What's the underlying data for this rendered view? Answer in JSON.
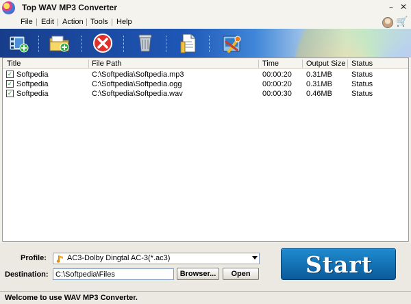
{
  "app": {
    "title": "Top WAV MP3 Converter"
  },
  "menu": [
    "File",
    "Edit",
    "Action",
    "Tools",
    "Help"
  ],
  "toolbar": {
    "buttons": [
      "add-video-files",
      "add-folder",
      "remove",
      "clear-all",
      "output-settings",
      "convert-settings"
    ]
  },
  "list": {
    "columns": [
      "Title",
      "File Path",
      "Time",
      "Output Size",
      "Status"
    ],
    "rows": [
      {
        "checked": true,
        "title": "Softpedia",
        "path": "C:\\Softpedia\\Softpedia.mp3",
        "time": "00:00:20",
        "size": "0.31MB",
        "status": "Status"
      },
      {
        "checked": true,
        "title": "Softpedia",
        "path": "C:\\Softpedia\\Softpedia.ogg",
        "time": "00:00:20",
        "size": "0.31MB",
        "status": "Status"
      },
      {
        "checked": true,
        "title": "Softpedia",
        "path": "C:\\Softpedia\\Softpedia.wav",
        "time": "00:00:30",
        "size": "0.46MB",
        "status": "Status"
      }
    ]
  },
  "bottom": {
    "profile_label": "Profile:",
    "profile_value": "AC3-Dolby Dingtal AC-3(*.ac3)",
    "destination_label": "Destination:",
    "destination_value": "C:\\Softpedia\\Files",
    "browse_label": "Browser...",
    "open_label": "Open",
    "start_label": "Start"
  },
  "status": {
    "message": "Welcome to use WAV MP3 Converter."
  },
  "colors": {
    "toolbar_dark": "#173d8a",
    "start_button": "#1f8bd0",
    "check_mark": "#21a121"
  }
}
